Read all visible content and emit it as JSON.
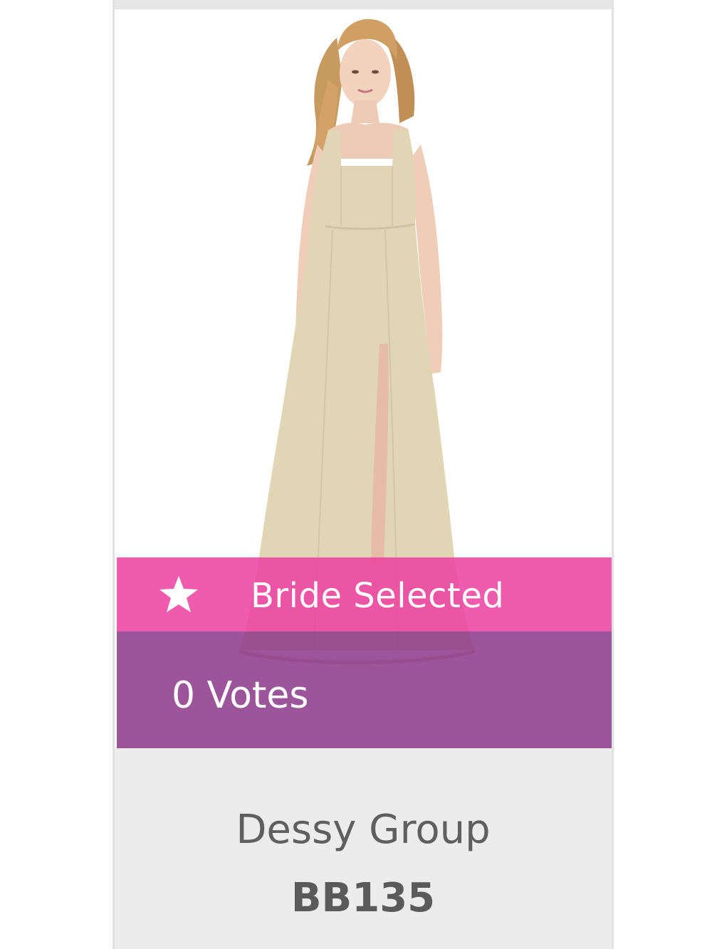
{
  "product": {
    "image_alt": "Model wearing a champagne satin sleeveless gown with square neckline and front slit",
    "bride_badge": {
      "icon": "star-icon",
      "label": "Bride Selected",
      "color": "#ec40a0"
    },
    "votes": {
      "label": "0 Votes",
      "count": 0,
      "color": "#8e3e8c"
    },
    "brand": "Dessy Group",
    "style_code": "BB135"
  },
  "colors": {
    "dress": "#e0d6b6",
    "info_background": "#ececec",
    "text_muted": "#5f5f5f"
  }
}
